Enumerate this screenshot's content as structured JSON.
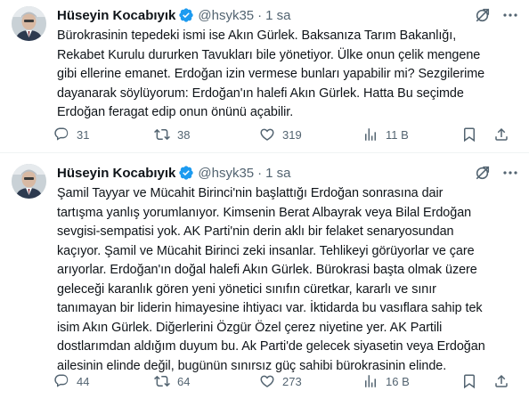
{
  "tweets": [
    {
      "author": "Hüseyin Kocabıyık",
      "handle": "@hsyk35",
      "dot": "·",
      "time": "1 sa",
      "text": "Bürokrasinin tepedeki ismi ise Akın Gürlek. Baksanıza Tarım Bakanlığı,\nRekabet Kurulu dururken Tavukları bile yönetiyor. Ülke onun çelik mengene\ngibi ellerine emanet. Erdoğan izin vermese bunları yapabilir mi? Sezgilerime\ndayanarak  söylüyorum: Erdoğan'ın halefi Akın Gürlek. Hatta Bu seçimde\nErdoğan feragat edip onun önünü açabilir.",
      "replies": "31",
      "retweets": "38",
      "likes": "319",
      "views": "11 B"
    },
    {
      "author": "Hüseyin Kocabıyık",
      "handle": "@hsyk35",
      "dot": "·",
      "time": "1 sa",
      "text": "Şamil Tayyar ve Mücahit Birinci'nin başlattığı Erdoğan sonrasına dair\ntartışma yanlış yorumlanıyor. Kimsenin Berat Albayrak veya Bilal Erdoğan\nsevgisi-sempatisi yok. AK Parti'nin derin aklı bir felaket senaryosundan\nkaçıyor. Şamil ve Mücahit Birinci zeki insanlar. Tehlikeyi görüyorlar ve çare\narıyorlar. Erdoğan'ın doğal halefi Akın Gürlek. Bürokrasi başta olmak üzere\ngeleceği karanlık gören yeni yönetici sınıfın cüretkar, kararlı ve sınır\ntanımayan bir liderin himayesine ihtiyacı var. İktidarda bu vasıflara sahip tek\nisim Akın Gürlek. Diğerlerini Özgür Özel çerez niyetine yer. AK Partili\ndostlarımdan aldığım duyum bu. Ak Parti'de gelecek siyasetin veya Erdoğan\nailesinin elinde değil, bugünün sınırsız güç sahibi bürokrasinin elinde.",
      "replies": "44",
      "retweets": "64",
      "likes": "273",
      "views": "16 B"
    }
  ],
  "colors": {
    "text": "#0f1419",
    "secondary": "#536471",
    "verified": "#1d9bf0",
    "divider": "#eff3f4"
  },
  "icons": [
    "verified-badge-icon",
    "grok-icon",
    "more-icon",
    "reply-icon",
    "retweet-icon",
    "like-icon",
    "views-icon",
    "bookmark-icon",
    "share-icon"
  ]
}
